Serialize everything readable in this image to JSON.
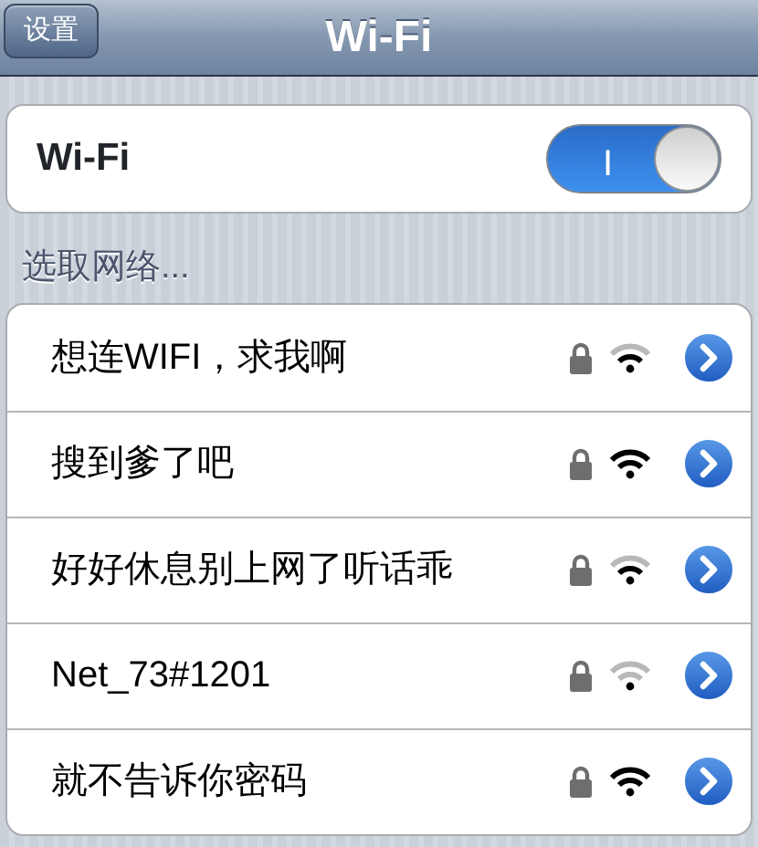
{
  "nav_bar": {
    "back_button": "设置",
    "title": "Wi-Fi"
  },
  "wifi_toggle": {
    "label": "Wi-Fi",
    "on": true,
    "on_label": "I"
  },
  "section_header": "选取网络...",
  "networks": [
    {
      "name": "想连WIFI，求我啊",
      "locked": true,
      "kind": "medium"
    },
    {
      "name": "搜到爹了吧",
      "locked": true,
      "kind": "strong"
    },
    {
      "name": "好好休息别上网了听话乖",
      "locked": true,
      "kind": "medium"
    },
    {
      "name": "Net_73#1201",
      "locked": true,
      "kind": "weak"
    },
    {
      "name": "就不告诉你密码",
      "locked": true,
      "kind": "strong"
    }
  ]
}
